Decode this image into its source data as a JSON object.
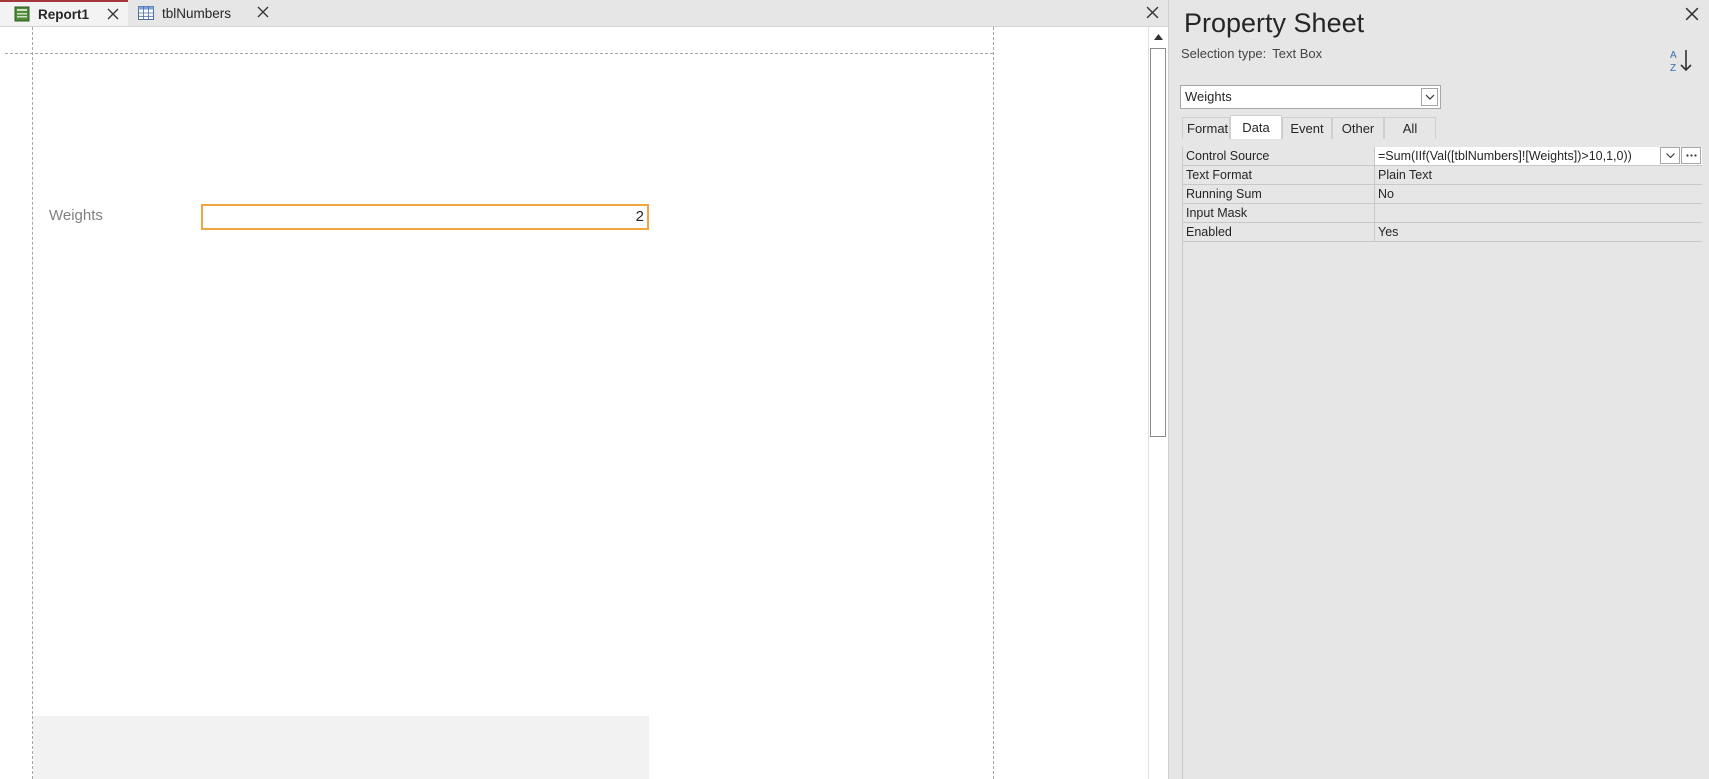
{
  "document": {
    "tabs": [
      {
        "label": "Report1",
        "icon": "report-icon",
        "active": true
      },
      {
        "label": "tblNumbers",
        "icon": "table-icon",
        "active": false
      }
    ]
  },
  "report": {
    "field_label": "Weights",
    "field_value": "2"
  },
  "property_sheet": {
    "title": "Property Sheet",
    "selection_type_label": "Selection type:",
    "selection_type_value": "Text Box",
    "object_selector": "Weights",
    "tabs": [
      "Format",
      "Data",
      "Event",
      "Other",
      "All"
    ],
    "active_tab": "Data",
    "properties": [
      {
        "name": "Control Source",
        "value": "=Sum(IIf(Val([tblNumbers]![Weights])>10,1,0))"
      },
      {
        "name": "Text Format",
        "value": "Plain Text"
      },
      {
        "name": "Running Sum",
        "value": "No"
      },
      {
        "name": "Input Mask",
        "value": ""
      },
      {
        "name": "Enabled",
        "value": "Yes"
      }
    ]
  },
  "colors": {
    "active_tab_accent": "#a4373a",
    "selected_control_border": "#f0a640",
    "panel_background": "#e6e6e6"
  }
}
